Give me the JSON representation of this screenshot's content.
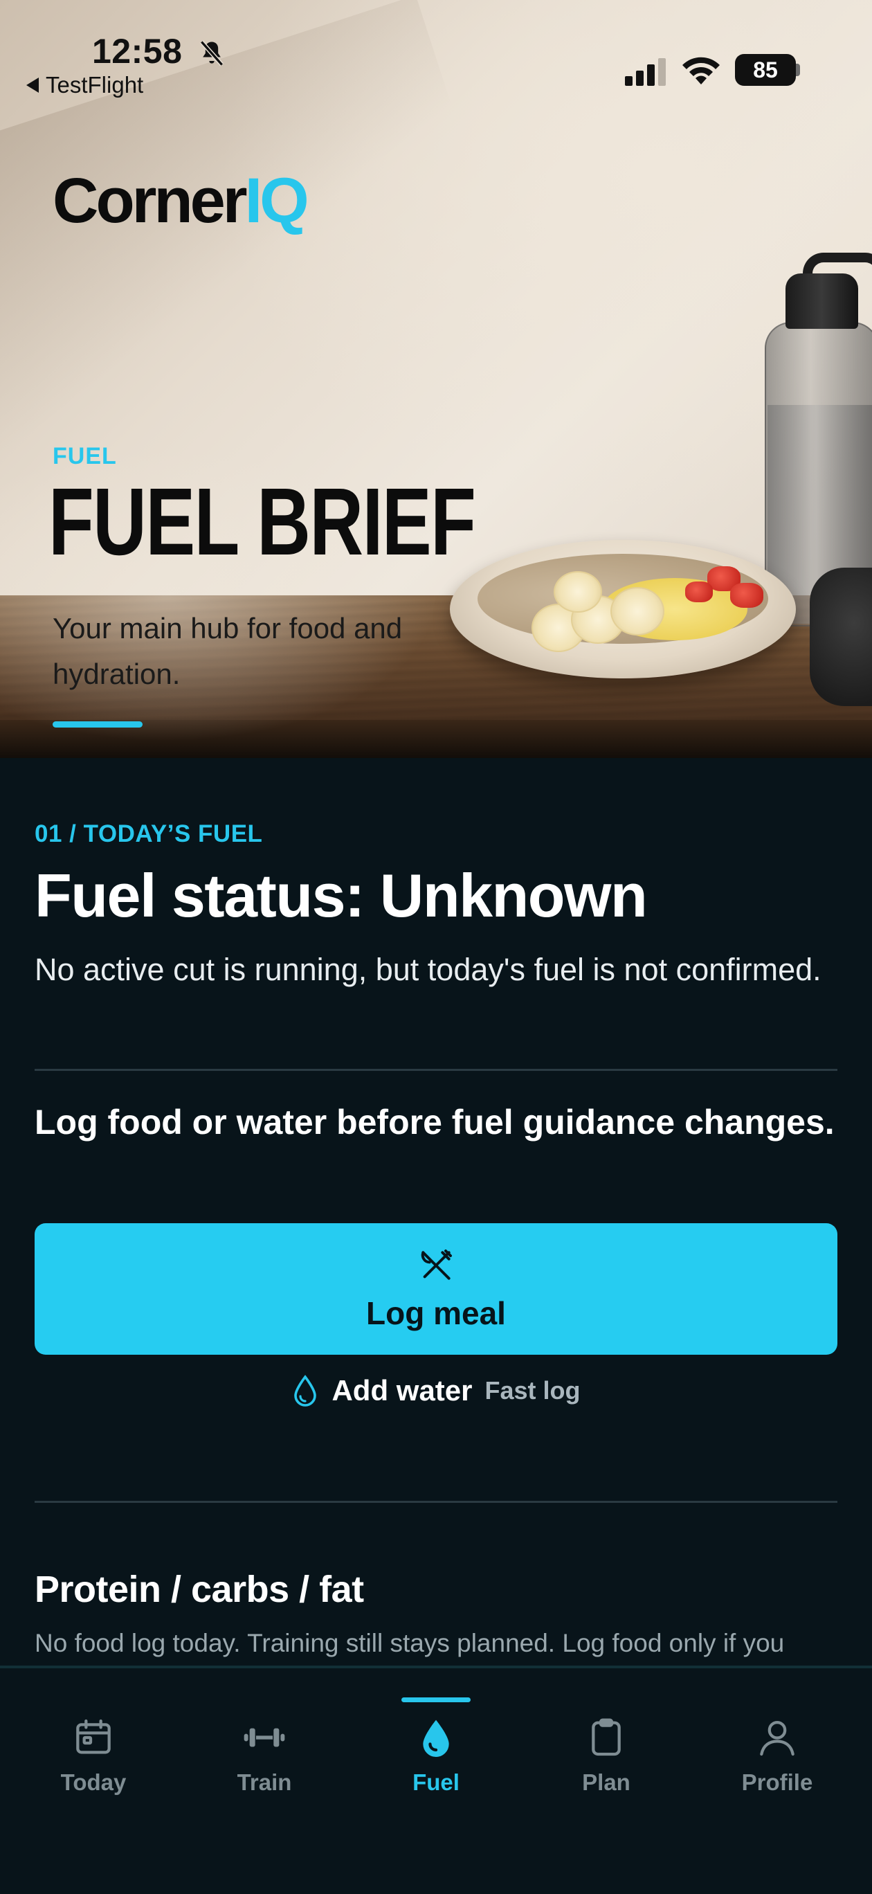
{
  "status_bar": {
    "time": "12:58",
    "back_app": "TestFlight",
    "battery": "85"
  },
  "hero": {
    "logo_main": "Corner",
    "logo_accent": "IQ",
    "eyebrow": "FUEL",
    "title": "FUEL BRIEF",
    "subtitle": "Your main hub for food and hydration."
  },
  "today": {
    "eyebrow": "01 / TODAY’S FUEL",
    "status_title": "Fuel status: Unknown",
    "status_desc": "No active cut is running, but today's fuel is not confirmed.",
    "guidance": "Log food or water before fuel guidance changes.",
    "log_meal_label": "Log meal",
    "add_water_label": "Add water",
    "fast_log_label": "Fast log"
  },
  "macros": {
    "title": "Protein / carbs / fat",
    "description": "No food log today. Training still stays planned. Log food only if you"
  },
  "tabbar": {
    "tabs": [
      {
        "label": "Today",
        "icon": "calendar-icon",
        "active": false
      },
      {
        "label": "Train",
        "icon": "dumbbell-icon",
        "active": false
      },
      {
        "label": "Fuel",
        "icon": "drop-icon",
        "active": true
      },
      {
        "label": "Plan",
        "icon": "clipboard-icon",
        "active": false
      },
      {
        "label": "Profile",
        "icon": "person-icon",
        "active": false
      }
    ]
  },
  "colors": {
    "accent": "#28c6ec",
    "background": "#08141a",
    "button": "#26ccf1"
  }
}
